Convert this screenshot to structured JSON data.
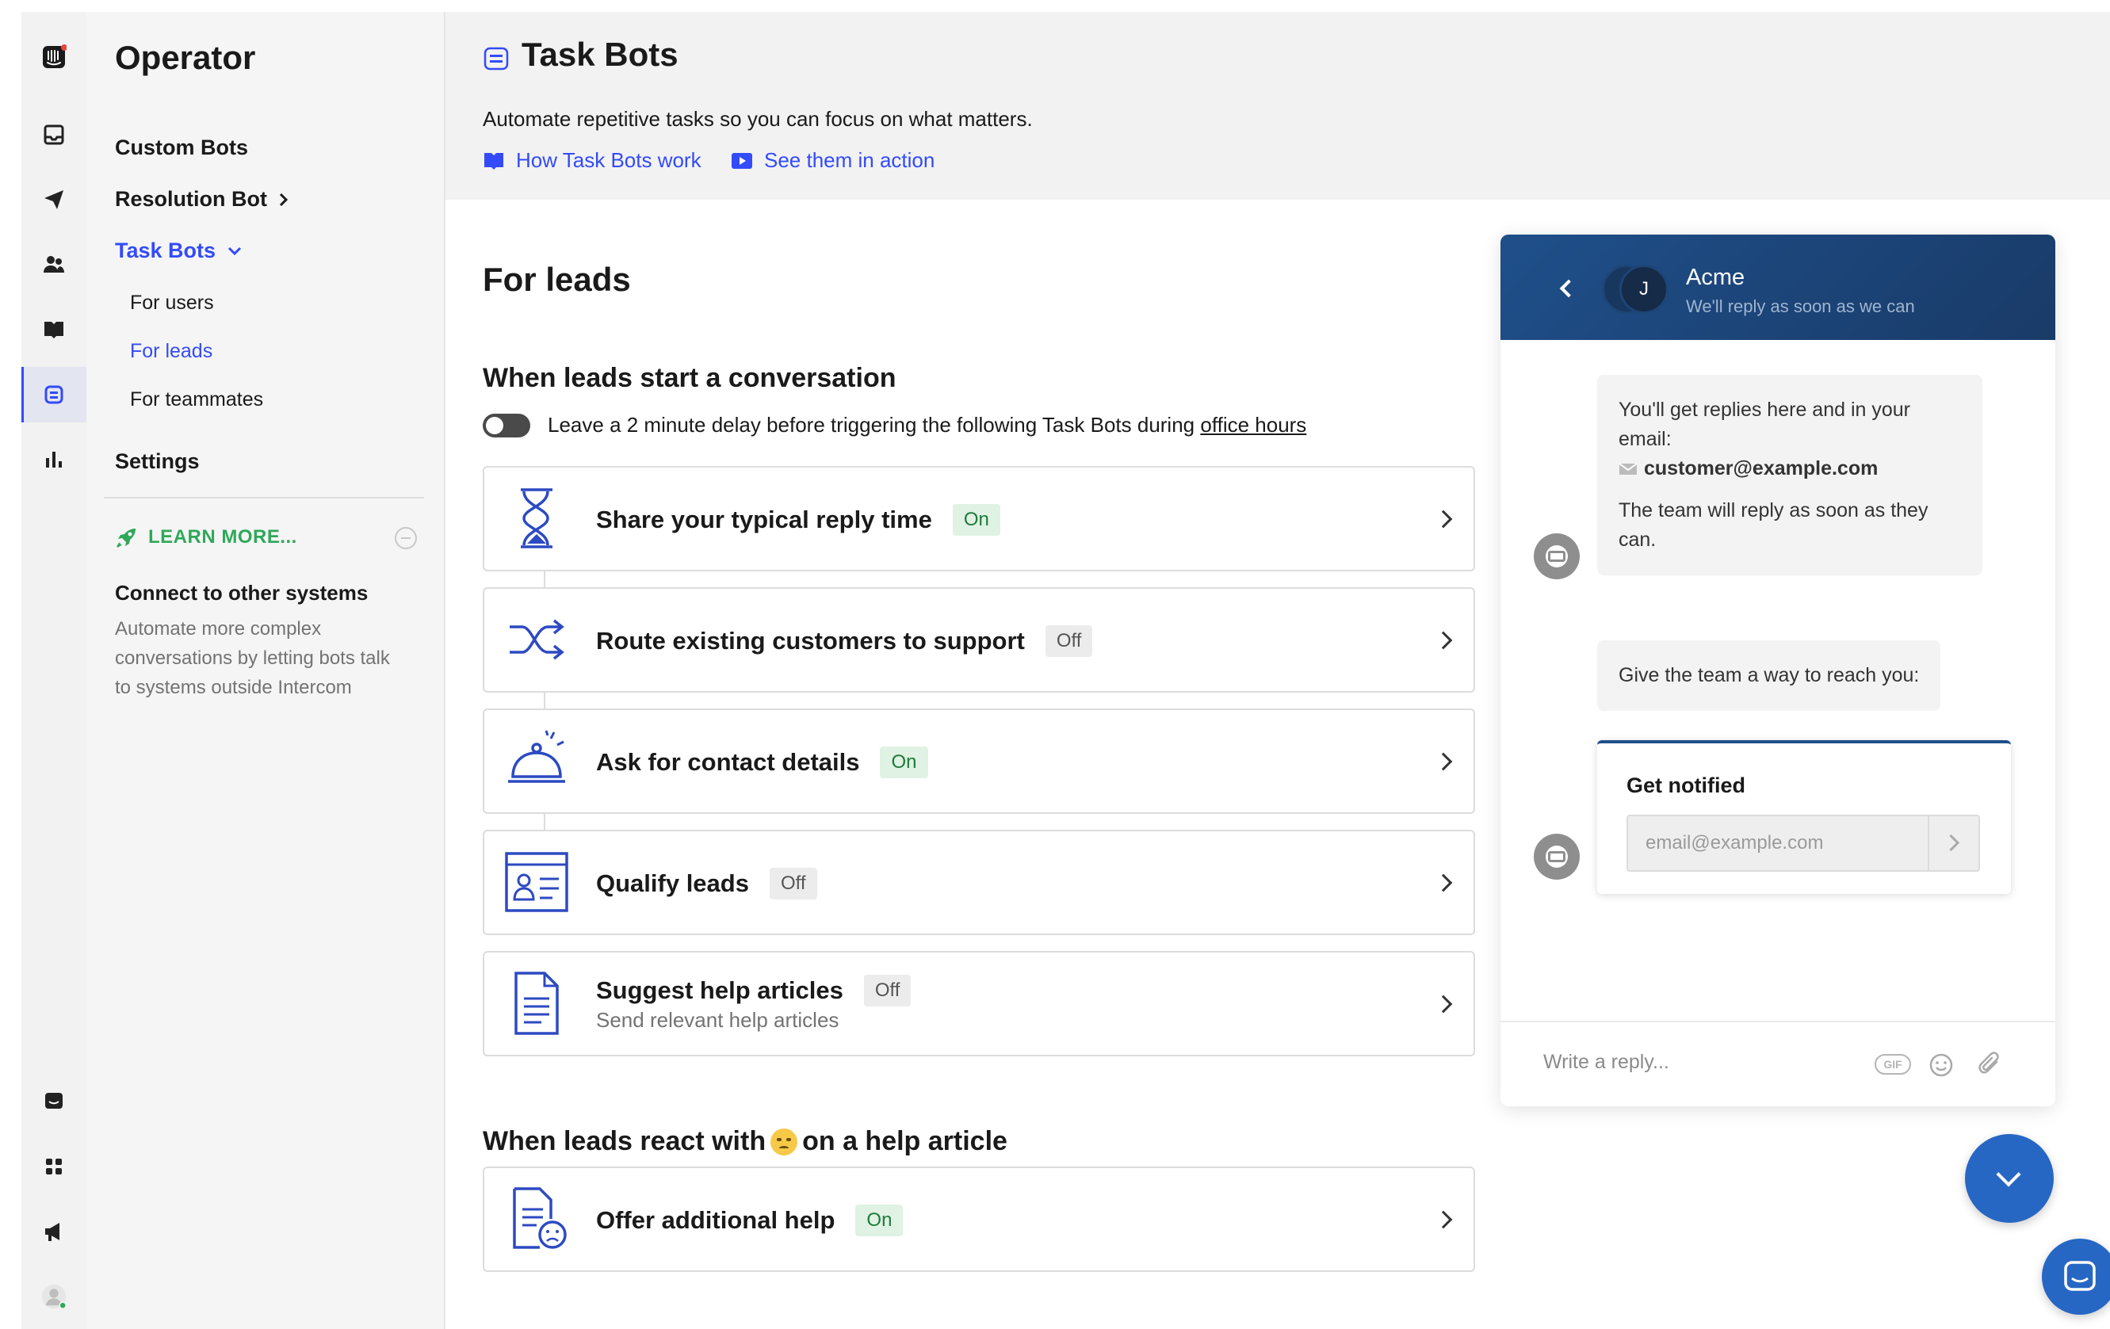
{
  "app": {
    "section": "Operator"
  },
  "nav": {
    "items": [
      {
        "label": "Custom Bots"
      },
      {
        "label": "Resolution Bot"
      },
      {
        "label": "Task Bots"
      }
    ],
    "sub_items": [
      {
        "label": "For users"
      },
      {
        "label": "For leads"
      },
      {
        "label": "For teammates"
      }
    ],
    "settings_label": "Settings",
    "learn_more": "LEARN MORE...",
    "connect_title": "Connect to other systems",
    "connect_text": "Automate more complex conversations by letting bots talk to systems outside Intercom"
  },
  "page": {
    "title": "Task Bots",
    "description": "Automate repetitive tasks so you can focus on what matters.",
    "link_how": "How Task Bots work",
    "link_see": "See them in action",
    "section_title": "For leads",
    "start_title": "When leads start a conversation",
    "delay_text": "Leave a 2 minute delay before triggering the following Task Bots during",
    "delay_link": "office hours",
    "react_title_pre": "When leads react with",
    "react_title_post": "on a help article"
  },
  "bots": [
    {
      "name": "Share your typical reply time",
      "status": "On"
    },
    {
      "name": "Route existing customers to support",
      "status": "Off"
    },
    {
      "name": "Ask for contact details",
      "status": "On"
    },
    {
      "name": "Qualify leads",
      "status": "Off"
    },
    {
      "name": "Suggest help articles",
      "status": "Off",
      "subtext": "Send relevant help articles"
    }
  ],
  "react_bots": [
    {
      "name": "Offer additional help",
      "status": "On"
    }
  ],
  "messenger": {
    "company": "Acme",
    "subtitle": "We'll reply as soon as we can",
    "avatar_initial": "J",
    "msg1_line1": "You'll get replies here and in your email:",
    "msg1_email": "customer@example.com",
    "msg1_line2": "The team will reply as soon as they can.",
    "msg2": "Give the team a way to reach you:",
    "card_title": "Get notified",
    "email_placeholder": "email@example.com",
    "reply_placeholder": "Write a reply...",
    "gif_label": "GIF"
  },
  "colors": {
    "accent": "#334bfa",
    "learn_green": "#2fa85a",
    "on_badge_bg": "#dff2e3",
    "off_badge_bg": "#ececec",
    "messenger_header": "#1f4f8a"
  }
}
